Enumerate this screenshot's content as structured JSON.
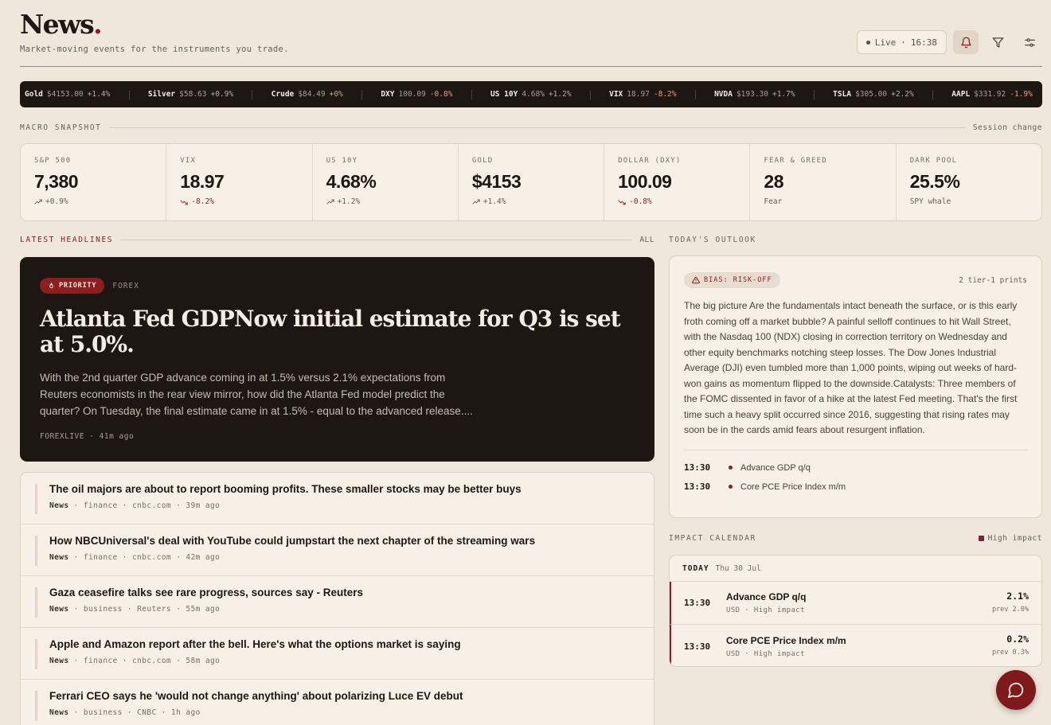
{
  "header": {
    "logo_text": "News",
    "logo_dot": ".",
    "tagline": "Market-moving events for the instruments you trade.",
    "live_label": "Live",
    "live_sep": "·",
    "live_time": "16:38",
    "icons": [
      "bell-icon",
      "filter-icon",
      "sliders-icon"
    ]
  },
  "ticker": [
    {
      "name": "Gold",
      "price": "$4153.00",
      "change": "+1.4%",
      "dir": "up"
    },
    {
      "name": "Silver",
      "price": "$58.63",
      "change": "+0.9%",
      "dir": "up"
    },
    {
      "name": "Crude",
      "price": "$84.49",
      "change": "+0%",
      "dir": "up"
    },
    {
      "name": "DXY",
      "price": "100.09",
      "change": "-0.8%",
      "dir": "down"
    },
    {
      "name": "US 10Y",
      "price": "4.68%",
      "change": "+1.2%",
      "dir": "up"
    },
    {
      "name": "VIX",
      "price": "18.97",
      "change": "-8.2%",
      "dir": "down"
    },
    {
      "name": "NVDA",
      "price": "$193.30",
      "change": "+1.7%",
      "dir": "up"
    },
    {
      "name": "TSLA",
      "price": "$305.00",
      "change": "+2.2%",
      "dir": "up"
    },
    {
      "name": "AAPL",
      "price": "$331.92",
      "change": "-1.9%",
      "dir": "down"
    }
  ],
  "macro": {
    "title": "MACRO SNAPSHOT",
    "aside": "Session change",
    "cells": [
      {
        "label": "S&P 500",
        "value": "7,380",
        "sub": "+0.9%",
        "trend": "up"
      },
      {
        "label": "VIX",
        "value": "18.97",
        "sub": "-8.2%",
        "trend": "down"
      },
      {
        "label": "US 10Y",
        "value": "4.68%",
        "sub": "+1.2%",
        "trend": "up"
      },
      {
        "label": "GOLD",
        "value": "$4153",
        "sub": "+1.4%",
        "trend": "up"
      },
      {
        "label": "DOLLAR (DXY)",
        "value": "100.09",
        "sub": "-0.8%",
        "trend": "down"
      },
      {
        "label": "FEAR & GREED",
        "value": "28",
        "sub": "Fear",
        "trend": "none"
      },
      {
        "label": "DARK POOL",
        "value": "25.5%",
        "sub": "SPY whale",
        "trend": "none"
      }
    ]
  },
  "headlines": {
    "title": "LATEST HEADLINES",
    "all_label": "ALL",
    "hero": {
      "badge": "PRIORITY",
      "category": "FOREX",
      "title": "Atlanta Fed GDPNow initial estimate for Q3 is set at 5.0%.",
      "summary": "With the 2nd quarter GDP advance coming in at 1.5% versus 2.1% expectations from Reuters economists in the rear view mirror, how did the Atlanta Fed model predict the quarter? On Tuesday, the final estimate came in at 1.5% - equal to the advanced release....",
      "source": "FOREXLIVE",
      "time": "41m ago"
    },
    "items": [
      {
        "title": "The oil majors are about to report booming profits. These smaller stocks may be better buys",
        "type": "News",
        "section": "finance",
        "source": "cnbc.com",
        "time": "39m ago"
      },
      {
        "title": "How NBCUniversal's deal with YouTube could jumpstart the next chapter of the streaming wars",
        "type": "News",
        "section": "finance",
        "source": "cnbc.com",
        "time": "42m ago"
      },
      {
        "title": "Gaza ceasefire talks see rare progress, sources say - Reuters",
        "type": "News",
        "section": "business",
        "source": "Reuters",
        "time": "55m ago"
      },
      {
        "title": "Apple and Amazon report after the bell. Here's what the options market is saying",
        "type": "News",
        "section": "finance",
        "source": "cnbc.com",
        "time": "58m ago"
      },
      {
        "title": "Ferrari CEO says he 'would not change anything' about polarizing Luce EV debut",
        "type": "News",
        "section": "business",
        "source": "CNBC",
        "time": "1h ago"
      }
    ]
  },
  "outlook": {
    "title": "TODAY'S OUTLOOK",
    "bias": "BIAS: RISK-OFF",
    "prints": "2 tier-1 prints",
    "body": "The big picture Are the fundamentals intact beneath the surface, or is this early froth coming off a market bubble? A painful selloff continues to hit Wall Street, with the Nasdaq 100 (NDX) closing in correction territory on Wednesday and other equity benchmarks notching steep losses. The Dow Jones Industrial Average (DJI) even tumbled more than 1,000 points, wiping out weeks of hard-won gains as momentum flipped to the downside.Catalysts: Three members of the FOMC dissented in favor of a hike at the latest Fed meeting. That's the first time such a heavy split occurred since 2016, suggesting that rising rates may soon be in the cards amid fears about resurgent inflation.",
    "events": [
      {
        "time": "13:30",
        "name": "Advance GDP q/q"
      },
      {
        "time": "13:30",
        "name": "Core PCE Price Index m/m"
      }
    ]
  },
  "calendar": {
    "title": "IMPACT CALENDAR",
    "legend": "High impact",
    "day_label": "TODAY",
    "date": "Thu 30 Jul",
    "rows": [
      {
        "time": "13:30",
        "name": "Advance GDP q/q",
        "sub": "USD · High impact",
        "value": "2.1%",
        "prev": "prev 2.0%"
      },
      {
        "time": "13:30",
        "name": "Core PCE Price Index m/m",
        "sub": "USD · High impact",
        "value": "0.2%",
        "prev": "prev 0.3%"
      }
    ]
  },
  "colors": {
    "accent": "#8b1e1e",
    "background": "#efe7db",
    "dark": "#1d1714",
    "card": "#f6f0e6"
  },
  "fab": {
    "icon": "chat-bubble-icon"
  }
}
